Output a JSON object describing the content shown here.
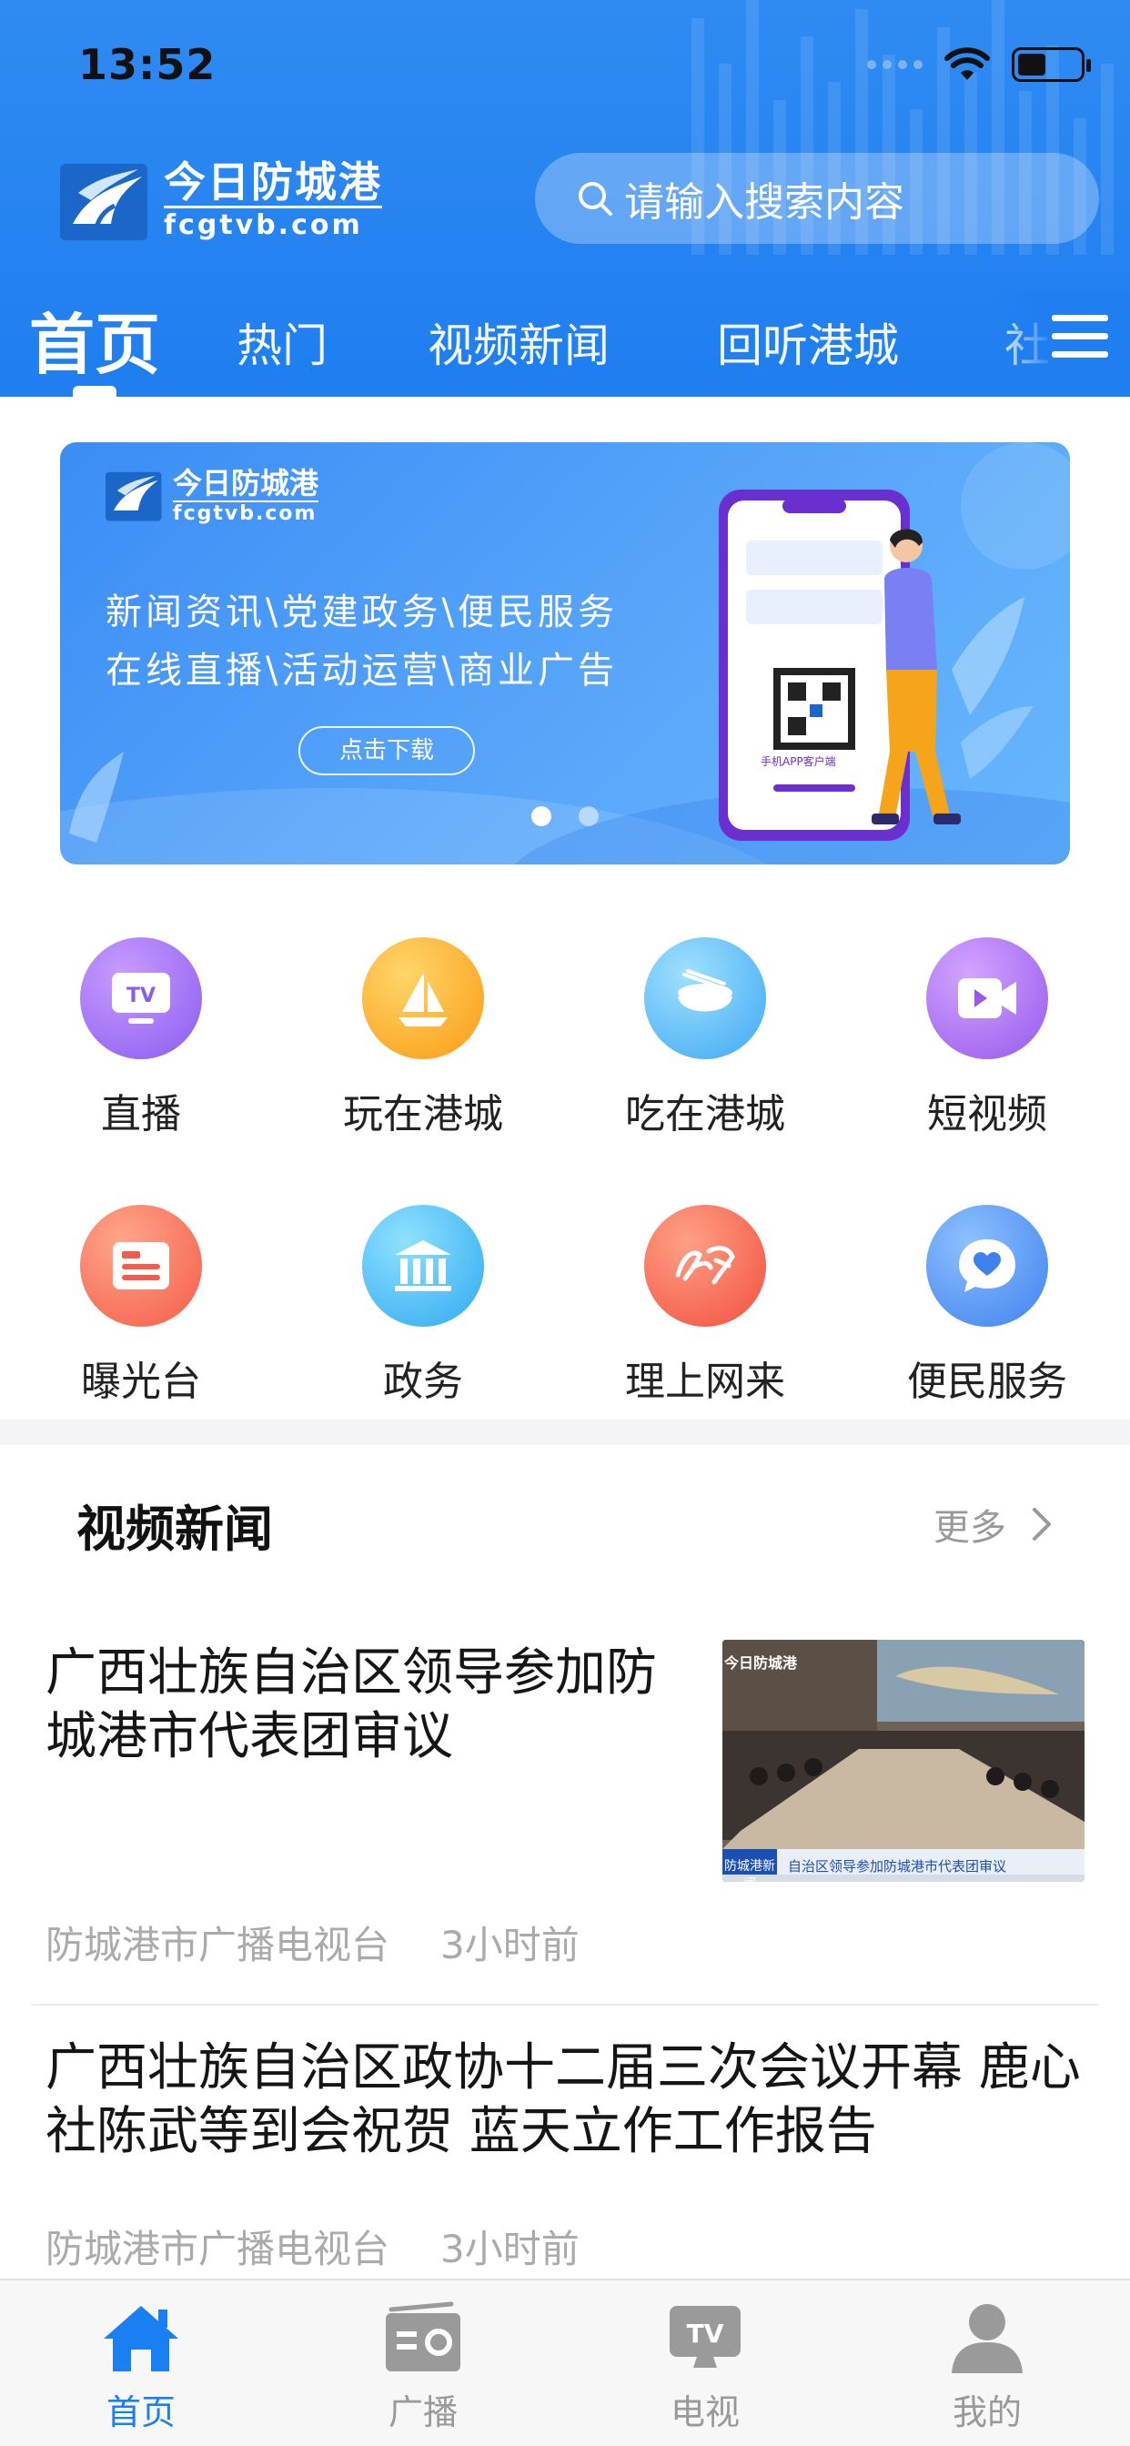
{
  "status_bar": {
    "time": "13:52",
    "battery_level": 0.45
  },
  "header": {
    "logo_cn": "今日防城港",
    "logo_en": "fcgtvb.com",
    "search_placeholder": "请输入搜索内容",
    "tabs": [
      {
        "label": "首页",
        "active": true
      },
      {
        "label": "热门"
      },
      {
        "label": "视频新闻"
      },
      {
        "label": "回听港城"
      },
      {
        "label": "社"
      }
    ]
  },
  "banner": {
    "logo_cn": "今日防城港",
    "logo_en": "fcgtvb.com",
    "line1": "新闻资讯\\党建政务\\便民服务",
    "line2": "在线直播\\活动运营\\商业广告",
    "button": "点击下载",
    "phone_caption": "手机APP客户端",
    "page_count": 2,
    "current_page": 1
  },
  "shortcuts": [
    {
      "label": "直播",
      "icon": "tv-icon",
      "color": "#9b6cf0"
    },
    {
      "label": "玩在港城",
      "icon": "sailboat-icon",
      "color": "#fbab1f"
    },
    {
      "label": "吃在港城",
      "icon": "bowl-icon",
      "color": "#53b8f5"
    },
    {
      "label": "短视频",
      "icon": "video-icon",
      "color": "#a066ef"
    },
    {
      "label": "曝光台",
      "icon": "notice-board-icon",
      "color": "#f86a52"
    },
    {
      "label": "政务",
      "icon": "government-building-icon",
      "color": "#3fb5f3"
    },
    {
      "label": "理上网来",
      "icon": "study-icon",
      "color": "#f6604c"
    },
    {
      "label": "便民服务",
      "icon": "heart-chat-icon",
      "color": "#4a8ff2"
    }
  ],
  "video_news": {
    "title": "视频新闻",
    "more": "更多",
    "items": [
      {
        "title": "广西壮族自治区领导参加防城港市代表团审议",
        "source": "防城港市广播电视台",
        "time": "3小时前",
        "thumb_caption_left": "防城港新闻",
        "thumb_caption": "自治区领导参加防城港市代表团审议",
        "thumb_logo": "今日防城港"
      },
      {
        "title": "广西壮族自治区政协十二届三次会议开幕 鹿心社陈武等到会祝贺 蓝天立作工作报告",
        "source": "防城港市广播电视台",
        "time": "3小时前"
      }
    ]
  },
  "tabbar": [
    {
      "label": "首页",
      "icon": "home-icon",
      "active": true
    },
    {
      "label": "广播",
      "icon": "radio-icon"
    },
    {
      "label": "电视",
      "icon": "tv-icon"
    },
    {
      "label": "我的",
      "icon": "user-icon"
    }
  ],
  "colors": {
    "primary": "#1f7ef0",
    "tab_active": "#1a7ff3",
    "muted": "#aaaaaa"
  }
}
